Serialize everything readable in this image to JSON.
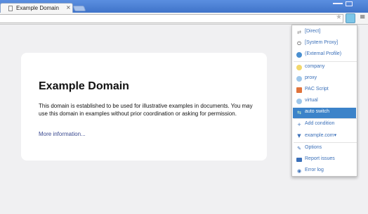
{
  "tab": {
    "title": "Example Domain",
    "close": "×"
  },
  "toolbar": {
    "star": "★",
    "menu": "≡"
  },
  "page": {
    "heading": "Example Domain",
    "body": "This domain is established to be used for illustrative examples in documents. You may use this domain in examples without prior coordination or asking for permission.",
    "link": "More information..."
  },
  "popup": {
    "items": [
      {
        "label": "[Direct]",
        "icon": "swap-arrows-icon",
        "glyph": "⇄",
        "color": "#888888"
      },
      {
        "label": "[System Proxy]",
        "icon": "power-icon",
        "glyph": "⏻",
        "color": "#222222"
      },
      {
        "label": "(External Profile)",
        "icon": "globe-icon",
        "glyph": "",
        "color": "#4a8fd0"
      },
      {
        "label": "company",
        "icon": "profile-dot-icon",
        "glyph": "",
        "color": "#f2d76b"
      },
      {
        "label": "proxy",
        "icon": "profile-dot-icon",
        "glyph": "",
        "color": "#9fc7ea"
      },
      {
        "label": "PAC Script",
        "icon": "script-file-icon",
        "glyph": "",
        "color": "#e0733b"
      },
      {
        "label": "virtual",
        "icon": "profile-dot-icon",
        "glyph": "",
        "color": "#9fc7ea"
      },
      {
        "label": "auto switch",
        "icon": "switch-icon",
        "glyph": "⇆",
        "color": "#5aa25a"
      },
      {
        "label": "Add condition",
        "icon": "plus-icon",
        "glyph": "+",
        "color": "#3a6fb8"
      },
      {
        "label": "example.com▾",
        "icon": "filter-icon",
        "glyph": "▼",
        "color": "#3a6fb8"
      },
      {
        "label": "Options",
        "icon": "wrench-icon",
        "glyph": "✎",
        "color": "#3a6fb8"
      },
      {
        "label": "Report issues",
        "icon": "comment-icon",
        "glyph": "",
        "color": "#3a6fb8"
      },
      {
        "label": "Error log",
        "icon": "circle-arrow-icon",
        "glyph": "◉",
        "color": "#3a6fb8"
      }
    ]
  }
}
